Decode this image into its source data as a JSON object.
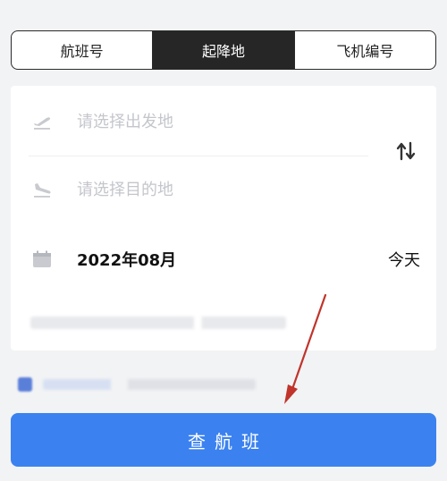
{
  "tabs": [
    {
      "label": "航班号",
      "active": false
    },
    {
      "label": "起降地",
      "active": true
    },
    {
      "label": "飞机编号",
      "active": false
    }
  ],
  "form": {
    "departure_placeholder": "请选择出发地",
    "destination_placeholder": "请选择目的地",
    "date_value": "2022年08月",
    "date_shortcut": "今天"
  },
  "search_button_label": "查航班",
  "icons": {
    "departure": "takeoff-icon",
    "arrival": "landing-icon",
    "swap": "swap-arrows-icon",
    "date": "calendar-icon"
  },
  "colors": {
    "accent": "#3b82f0",
    "active_tab": "#262626",
    "annotation_arrow": "#c0342b"
  }
}
